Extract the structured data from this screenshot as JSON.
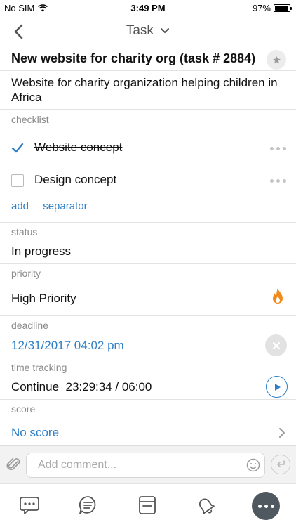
{
  "status_bar": {
    "carrier": "No SIM",
    "time": "3:49 PM",
    "battery": "97%",
    "battery_level": 0.97
  },
  "nav": {
    "title": "Task"
  },
  "task": {
    "title": "New website for charity org (task # 2884)",
    "description": "Website for charity organization helping children in Africa"
  },
  "checklist": {
    "label": "checklist",
    "items": [
      {
        "text": "Website concept",
        "checked": true
      },
      {
        "text": "Design concept",
        "checked": false
      }
    ],
    "add_label": "add",
    "separator_label": "separator"
  },
  "status": {
    "label": "status",
    "value": "In progress"
  },
  "priority": {
    "label": "priority",
    "value": "High Priority",
    "icon": "fire-icon"
  },
  "deadline": {
    "label": "deadline",
    "value": "12/31/2017 04:02 pm"
  },
  "time_tracking": {
    "label": "time tracking",
    "value": "Continue  23:29:34 / 06:00"
  },
  "score": {
    "label": "score",
    "value": "No score"
  },
  "comment": {
    "placeholder": "Add comment..."
  },
  "colors": {
    "accent": "#2f80c8",
    "fire": "#f08a1c",
    "more_button": "#50585f"
  },
  "tabs": [
    "chat-icon",
    "discussion-icon",
    "notes-icon",
    "bell-icon",
    "more-icon"
  ]
}
